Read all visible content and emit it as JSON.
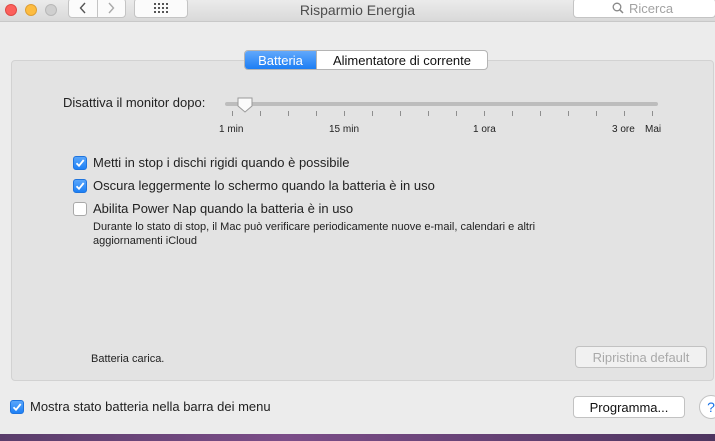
{
  "window": {
    "title": "Risparmio Energia",
    "search_placeholder": "Ricerca",
    "icons": {
      "back": "chevron-left-icon",
      "forward": "chevron-right-icon",
      "grid": "grid-icon",
      "search": "magnifier-icon"
    }
  },
  "tabs": [
    {
      "label": "Batteria",
      "selected": true
    },
    {
      "label": "Alimentatore di corrente",
      "selected": false
    }
  ],
  "slider": {
    "label": "Disattiva il monitor dopo:",
    "value": "1 min",
    "ticks": [
      "1 min",
      "15 min",
      "1 ora",
      "3 ore",
      "Mai"
    ]
  },
  "options": [
    {
      "label": "Metti in stop i dischi rigidi quando è possibile",
      "checked": true
    },
    {
      "label": "Oscura leggermente lo schermo quando la batteria è in uso",
      "checked": true
    },
    {
      "label": "Abilita Power Nap quando la batteria è in uso",
      "checked": false
    }
  ],
  "power_nap_note": "Durante lo stato di stop, il Mac può verificare periodicamente nuove e-mail, calendari e altri aggiornamenti iCloud",
  "status_text": "Batteria carica.",
  "restore_button": "Ripristina default",
  "show_status": {
    "label": "Mostra stato batteria nella barra dei menu",
    "checked": true
  },
  "schedule_button": "Programma...",
  "help_label": "?",
  "colors": {
    "accent": "#1c7ef4",
    "close": "#fc605c",
    "minimize": "#fdbc40"
  }
}
